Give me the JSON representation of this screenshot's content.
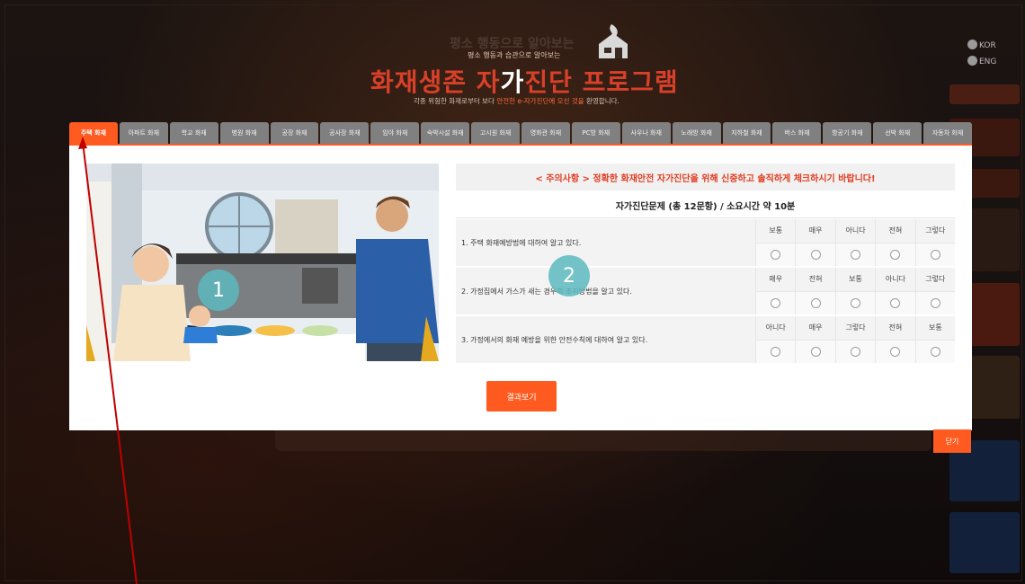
{
  "header": {
    "ghost_subtitle": "평소 행동으로 알아보는",
    "subtitle": "평소 행동과 습관으로 알아보는",
    "title_part1": "화재생존 자",
    "title_part2": "가",
    "title_part3": "진단 프로그램",
    "desc_part1": "각종 위험한 화재로부터 보다 ",
    "desc_em": "안전한 e-자가진단에 오신 것을",
    "desc_part2": " 환영합니다."
  },
  "lang": {
    "kor": "KOR",
    "eng": "ENG"
  },
  "tabs": [
    {
      "label": "주택 화재",
      "active": true
    },
    {
      "label": "아파트 화재"
    },
    {
      "label": "학교 화재"
    },
    {
      "label": "병원 화재"
    },
    {
      "label": "공장 화재"
    },
    {
      "label": "공사장 화재"
    },
    {
      "label": "임야 화재"
    },
    {
      "label": "숙박시설 화재"
    },
    {
      "label": "고시원 화재"
    },
    {
      "label": "영화관 화재"
    },
    {
      "label": "PC방 화재"
    },
    {
      "label": "사우나 화재"
    },
    {
      "label": "노래방 화재"
    },
    {
      "label": "지하철 화재"
    },
    {
      "label": "버스 화재"
    },
    {
      "label": "항공기 화재"
    },
    {
      "label": "선박 화재"
    },
    {
      "label": "자동차 화재"
    }
  ],
  "notice": "< 주의사항 > 정확한 화재안전 자가진단을 위해 신중하고 솔직하게 체크하시기 바랍니다!",
  "questions_title": "자가진단문제 (총 12문항) / 소요시간 약 10분",
  "questions": [
    {
      "text": "1. 주택 화재예방법에 대하여 알고 있다.",
      "options": [
        "보통",
        "매우",
        "아니다",
        "전혀",
        "그렇다"
      ]
    },
    {
      "text": "2. 가정집에서 가스가 새는 경우의 조치방법을 알고 있다.",
      "options": [
        "매우",
        "전혀",
        "보통",
        "아니다",
        "그렇다"
      ]
    },
    {
      "text": "3. 가정에서의 화재 예방을 위한 안전수칙에 대하여 알고 있다.",
      "options": [
        "아니다",
        "매우",
        "그렇다",
        "전혀",
        "보통"
      ]
    }
  ],
  "badges": {
    "image": "1",
    "questions": "2"
  },
  "buttons": {
    "result": "결과보기",
    "close": "닫기"
  },
  "colors": {
    "accent": "#ff5a1f",
    "tab_inactive": "#808080",
    "title_red": "#d8402a",
    "notice_red": "#e23b1f",
    "badge": "#5cb8be"
  }
}
